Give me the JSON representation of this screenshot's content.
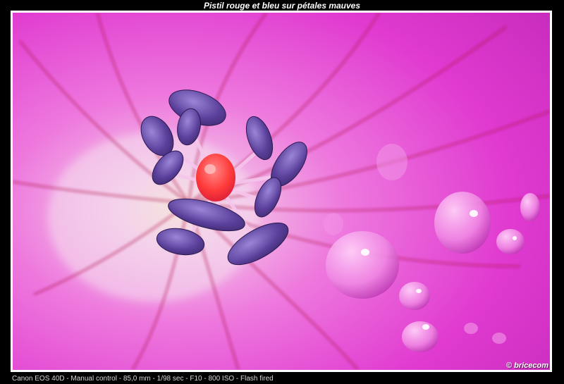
{
  "title": "Pistil rouge et bleu sur pétales mauves",
  "watermark": "© bricecom",
  "caption": "Canon EOS 40D - Manual control - 85,0 mm - 1/98 sec - F10 - 800 ISO - Flash fired",
  "colors": {
    "background": "#000000",
    "petal": "#e03ad0",
    "petal_light": "#f5a8ee",
    "vein": "#b0124a",
    "anther": "#5a3f9a",
    "pistil": "#ff3b3b",
    "center_glow": "#f3e8c8"
  }
}
